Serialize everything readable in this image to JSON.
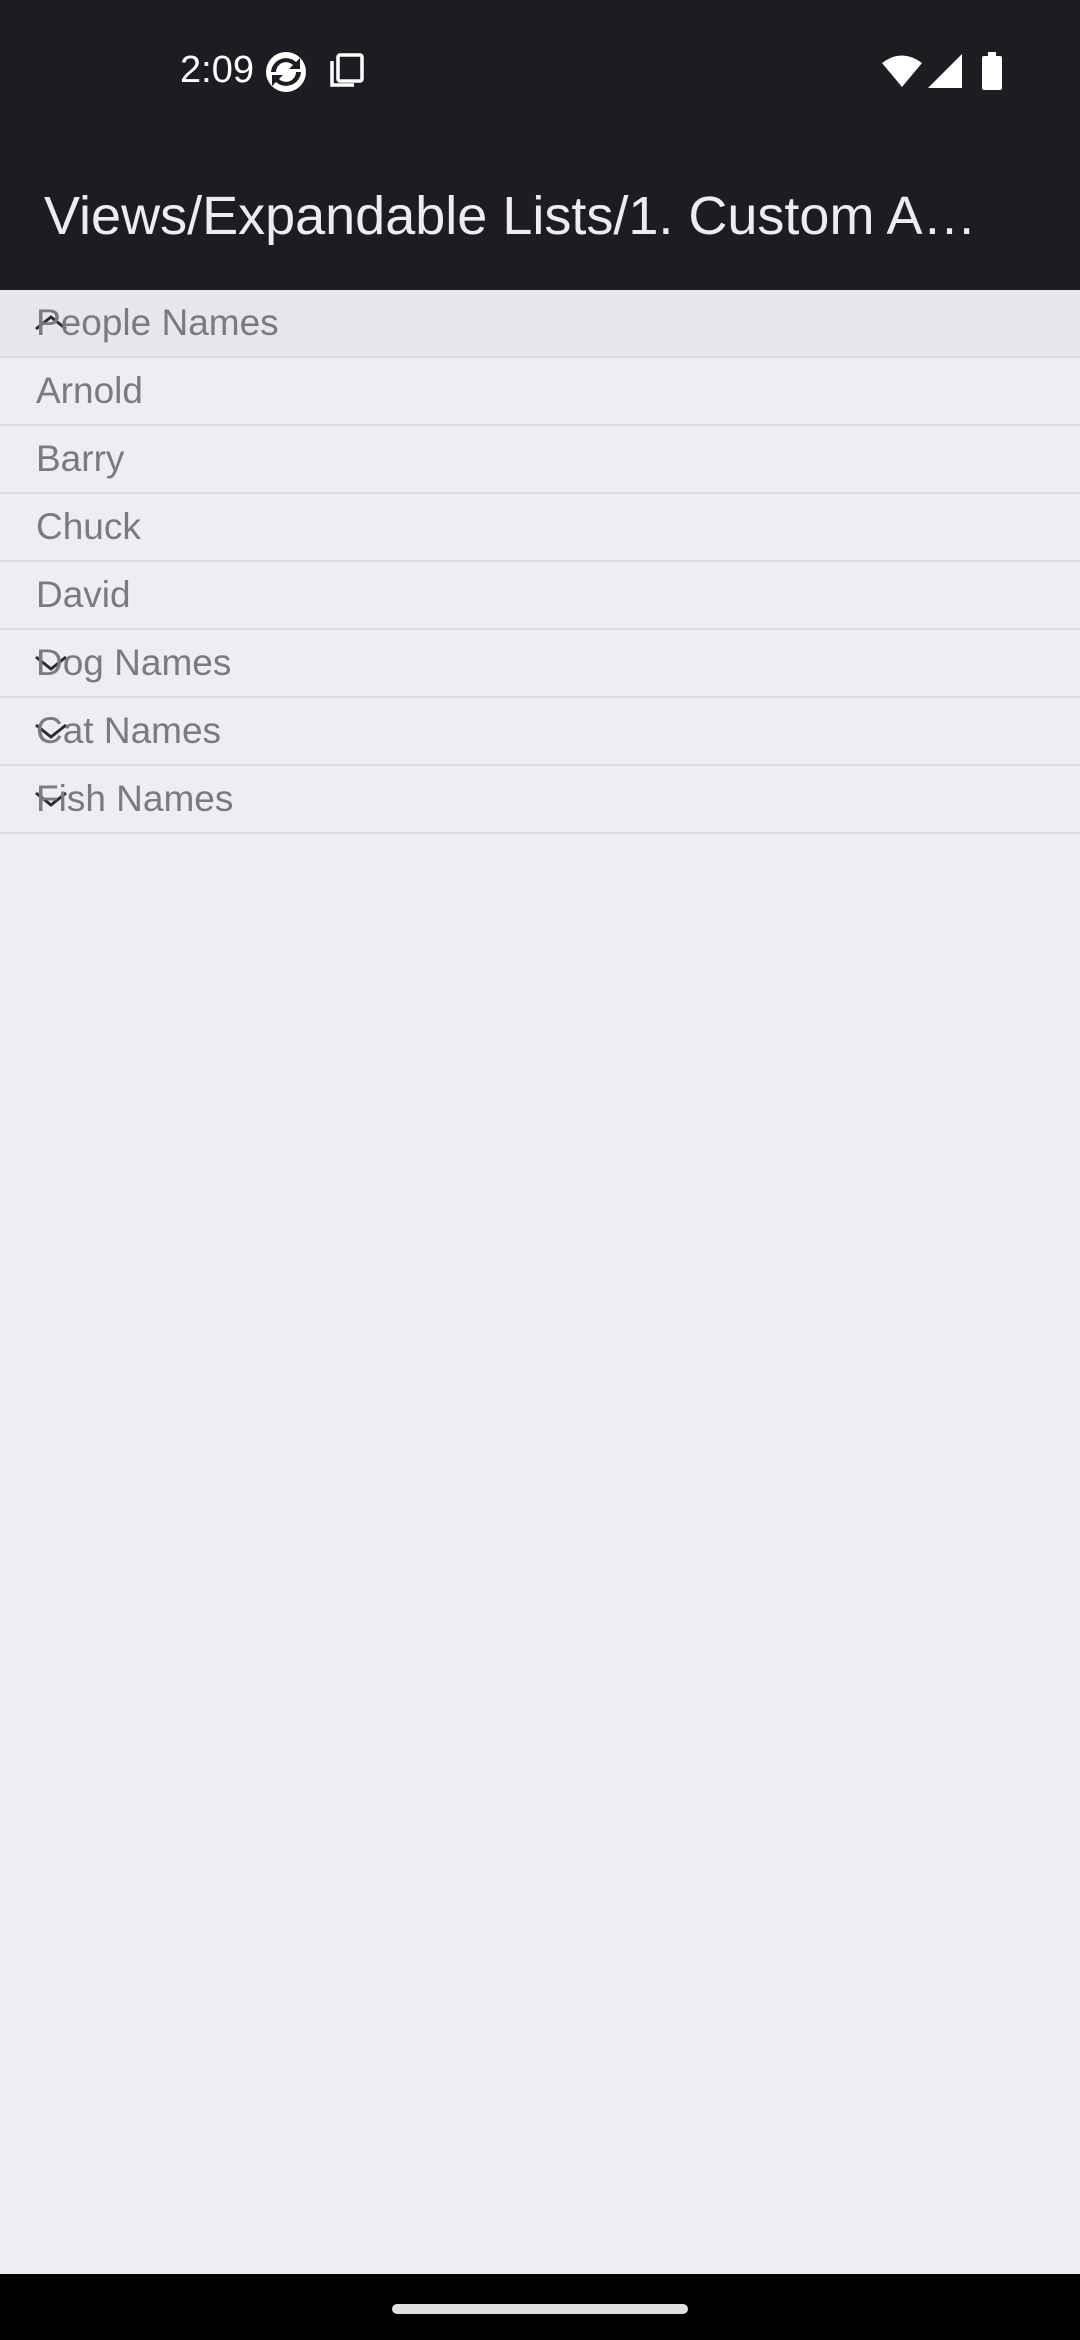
{
  "status_bar": {
    "time": "2:09"
  },
  "app_bar": {
    "title": "Views/Expandable Lists/1. Custom A…"
  },
  "list": {
    "groups": [
      {
        "label": "People Names",
        "expanded": true,
        "children": [
          "Arnold",
          "Barry",
          "Chuck",
          "David"
        ]
      },
      {
        "label": "Dog Names",
        "expanded": false
      },
      {
        "label": "Cat Names",
        "expanded": false
      },
      {
        "label": "Fish Names",
        "expanded": false
      }
    ]
  },
  "colors": {
    "app_bar_bg": "#1c1c22",
    "list_bg": "#eeedf3",
    "row_text": "#7a7a80",
    "divider": "#dcdbe2"
  },
  "icons": {
    "status_bar": [
      "sync-icon",
      "screenshot-icon",
      "wifi-icon",
      "cell-signal-icon",
      "battery-icon"
    ],
    "group_indicator_expanded": "chevron-up-icon",
    "group_indicator_collapsed": "chevron-down-icon"
  }
}
